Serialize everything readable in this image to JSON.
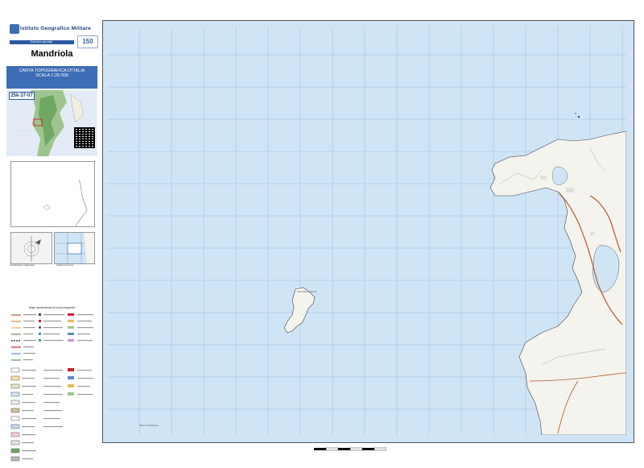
{
  "header": {
    "org_name": "Istituto Geografico Militare",
    "edition_label": "Edizione speciale",
    "anniversary_badge": "150"
  },
  "sheet": {
    "name": "Mandriola",
    "series_title_line1": "CARTA TOPOGRAFICA D'ITALIA",
    "series_title_line2": "SCALA 1:25 000",
    "code": "25k-37-07"
  },
  "sidebar": {
    "declination_caption": "Declinazione magnetica",
    "adjacent_caption": "Quadro di unione",
    "legend_title": "Segni convenzionali di uso più frequente"
  },
  "map": {
    "labels": {
      "island": "Isola Mal di Ventre",
      "sea": "Mare di Sardegna"
    },
    "colors": {
      "sea": "#cfe5f6",
      "land": "#f4f3ee",
      "road": "#b35a2a",
      "grid": "#9cbcd8",
      "frame": "#555555",
      "title_blue": "#3c6db5"
    }
  }
}
